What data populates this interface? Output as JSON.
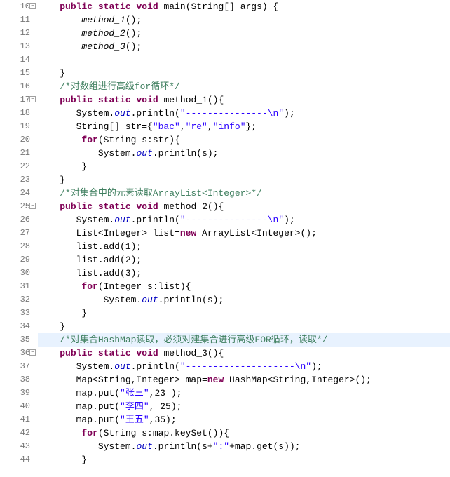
{
  "editor": {
    "highlighted_line": 35,
    "lines": [
      {
        "num": 10,
        "fold": true,
        "tokens": [
          {
            "cls": "plain",
            "t": "    "
          },
          {
            "cls": "kw",
            "t": "public"
          },
          {
            "cls": "plain",
            "t": " "
          },
          {
            "cls": "kw",
            "t": "static"
          },
          {
            "cls": "plain",
            "t": " "
          },
          {
            "cls": "kw",
            "t": "void"
          },
          {
            "cls": "plain",
            "t": " main(String[] args) {"
          }
        ]
      },
      {
        "num": 11,
        "tokens": [
          {
            "cls": "plain",
            "t": "        "
          },
          {
            "cls": "meth",
            "t": "method_1"
          },
          {
            "cls": "plain",
            "t": "();"
          }
        ]
      },
      {
        "num": 12,
        "tokens": [
          {
            "cls": "plain",
            "t": "        "
          },
          {
            "cls": "meth",
            "t": "method_2"
          },
          {
            "cls": "plain",
            "t": "();"
          }
        ]
      },
      {
        "num": 13,
        "tokens": [
          {
            "cls": "plain",
            "t": "        "
          },
          {
            "cls": "meth",
            "t": "method_3"
          },
          {
            "cls": "plain",
            "t": "();"
          }
        ]
      },
      {
        "num": 14,
        "tokens": []
      },
      {
        "num": 15,
        "tokens": [
          {
            "cls": "plain",
            "t": "    }"
          }
        ]
      },
      {
        "num": 16,
        "tokens": [
          {
            "cls": "plain",
            "t": "    "
          },
          {
            "cls": "cmt",
            "t": "/*对数组进行高级for循环*/"
          }
        ]
      },
      {
        "num": 17,
        "fold": true,
        "tokens": [
          {
            "cls": "plain",
            "t": "    "
          },
          {
            "cls": "kw",
            "t": "public"
          },
          {
            "cls": "plain",
            "t": " "
          },
          {
            "cls": "kw",
            "t": "static"
          },
          {
            "cls": "plain",
            "t": " "
          },
          {
            "cls": "kw",
            "t": "void"
          },
          {
            "cls": "plain",
            "t": " method_1(){"
          }
        ]
      },
      {
        "num": 18,
        "tokens": [
          {
            "cls": "plain",
            "t": "       System."
          },
          {
            "cls": "field",
            "t": "out"
          },
          {
            "cls": "plain",
            "t": ".println("
          },
          {
            "cls": "str",
            "t": "\"---------------\\n\""
          },
          {
            "cls": "plain",
            "t": ");"
          }
        ]
      },
      {
        "num": 19,
        "tokens": [
          {
            "cls": "plain",
            "t": "       String[] str={"
          },
          {
            "cls": "str",
            "t": "\"bac\""
          },
          {
            "cls": "plain",
            "t": ","
          },
          {
            "cls": "str",
            "t": "\"re\""
          },
          {
            "cls": "plain",
            "t": ","
          },
          {
            "cls": "str",
            "t": "\"info\""
          },
          {
            "cls": "plain",
            "t": "};"
          }
        ]
      },
      {
        "num": 20,
        "tokens": [
          {
            "cls": "plain",
            "t": "        "
          },
          {
            "cls": "kw",
            "t": "for"
          },
          {
            "cls": "plain",
            "t": "(String s:str){"
          }
        ]
      },
      {
        "num": 21,
        "tokens": [
          {
            "cls": "plain",
            "t": "           System."
          },
          {
            "cls": "field",
            "t": "out"
          },
          {
            "cls": "plain",
            "t": ".println(s);"
          }
        ]
      },
      {
        "num": 22,
        "tokens": [
          {
            "cls": "plain",
            "t": "        }"
          }
        ]
      },
      {
        "num": 23,
        "tokens": [
          {
            "cls": "plain",
            "t": "    }"
          }
        ]
      },
      {
        "num": 24,
        "tokens": [
          {
            "cls": "plain",
            "t": "    "
          },
          {
            "cls": "cmt",
            "t": "/*对集合中的元素读取ArrayList<Integer>*/"
          }
        ]
      },
      {
        "num": 25,
        "fold": true,
        "tokens": [
          {
            "cls": "plain",
            "t": "    "
          },
          {
            "cls": "kw",
            "t": "public"
          },
          {
            "cls": "plain",
            "t": " "
          },
          {
            "cls": "kw",
            "t": "static"
          },
          {
            "cls": "plain",
            "t": " "
          },
          {
            "cls": "kw",
            "t": "void"
          },
          {
            "cls": "plain",
            "t": " method_2(){"
          }
        ]
      },
      {
        "num": 26,
        "tokens": [
          {
            "cls": "plain",
            "t": "       System."
          },
          {
            "cls": "field",
            "t": "out"
          },
          {
            "cls": "plain",
            "t": ".println("
          },
          {
            "cls": "str",
            "t": "\"---------------\\n\""
          },
          {
            "cls": "plain",
            "t": ");"
          }
        ]
      },
      {
        "num": 27,
        "tokens": [
          {
            "cls": "plain",
            "t": "       List<Integer> list="
          },
          {
            "cls": "kw",
            "t": "new"
          },
          {
            "cls": "plain",
            "t": " ArrayList<Integer>();"
          }
        ]
      },
      {
        "num": 28,
        "tokens": [
          {
            "cls": "plain",
            "t": "       list.add(1);"
          }
        ]
      },
      {
        "num": 29,
        "tokens": [
          {
            "cls": "plain",
            "t": "       list.add(2);"
          }
        ]
      },
      {
        "num": 30,
        "tokens": [
          {
            "cls": "plain",
            "t": "       list.add(3);"
          }
        ]
      },
      {
        "num": 31,
        "tokens": [
          {
            "cls": "plain",
            "t": "        "
          },
          {
            "cls": "kw",
            "t": "for"
          },
          {
            "cls": "plain",
            "t": "(Integer s:list){"
          }
        ]
      },
      {
        "num": 32,
        "tokens": [
          {
            "cls": "plain",
            "t": "            System."
          },
          {
            "cls": "field",
            "t": "out"
          },
          {
            "cls": "plain",
            "t": ".println(s);"
          }
        ]
      },
      {
        "num": 33,
        "tokens": [
          {
            "cls": "plain",
            "t": "        }"
          }
        ]
      },
      {
        "num": 34,
        "tokens": [
          {
            "cls": "plain",
            "t": "    }"
          }
        ]
      },
      {
        "num": 35,
        "tokens": [
          {
            "cls": "plain",
            "t": "    "
          },
          {
            "cls": "cmt",
            "t": "/*对集合HashMap读取，必须对建集合进行高级FOR循环，读取*/"
          }
        ]
      },
      {
        "num": 36,
        "fold": true,
        "tokens": [
          {
            "cls": "plain",
            "t": "    "
          },
          {
            "cls": "kw",
            "t": "public"
          },
          {
            "cls": "plain",
            "t": " "
          },
          {
            "cls": "kw",
            "t": "static"
          },
          {
            "cls": "plain",
            "t": " "
          },
          {
            "cls": "kw",
            "t": "void"
          },
          {
            "cls": "plain",
            "t": " method_3(){"
          }
        ]
      },
      {
        "num": 37,
        "tokens": [
          {
            "cls": "plain",
            "t": "       System."
          },
          {
            "cls": "field",
            "t": "out"
          },
          {
            "cls": "plain",
            "t": ".println("
          },
          {
            "cls": "str",
            "t": "\"--------------------\\n\""
          },
          {
            "cls": "plain",
            "t": ");"
          }
        ]
      },
      {
        "num": 38,
        "tokens": [
          {
            "cls": "plain",
            "t": "       Map<String,Integer> map="
          },
          {
            "cls": "kw",
            "t": "new"
          },
          {
            "cls": "plain",
            "t": " HashMap<String,Integer>();"
          }
        ]
      },
      {
        "num": 39,
        "tokens": [
          {
            "cls": "plain",
            "t": "       map.put("
          },
          {
            "cls": "str",
            "t": "\"张三\""
          },
          {
            "cls": "plain",
            "t": ",23 );"
          }
        ]
      },
      {
        "num": 40,
        "tokens": [
          {
            "cls": "plain",
            "t": "       map.put("
          },
          {
            "cls": "str",
            "t": "\"李四\""
          },
          {
            "cls": "plain",
            "t": ", 25);"
          }
        ]
      },
      {
        "num": 41,
        "tokens": [
          {
            "cls": "plain",
            "t": "       map.put("
          },
          {
            "cls": "str",
            "t": "\"王五\""
          },
          {
            "cls": "plain",
            "t": ",35);"
          }
        ]
      },
      {
        "num": 42,
        "tokens": [
          {
            "cls": "plain",
            "t": "        "
          },
          {
            "cls": "kw",
            "t": "for"
          },
          {
            "cls": "plain",
            "t": "(String s:map.keySet()){"
          }
        ]
      },
      {
        "num": 43,
        "tokens": [
          {
            "cls": "plain",
            "t": "           System."
          },
          {
            "cls": "field",
            "t": "out"
          },
          {
            "cls": "plain",
            "t": ".println(s+"
          },
          {
            "cls": "str",
            "t": "\":\""
          },
          {
            "cls": "plain",
            "t": "+map.get(s));"
          }
        ]
      },
      {
        "num": 44,
        "tokens": [
          {
            "cls": "plain",
            "t": "        }"
          }
        ]
      }
    ]
  }
}
